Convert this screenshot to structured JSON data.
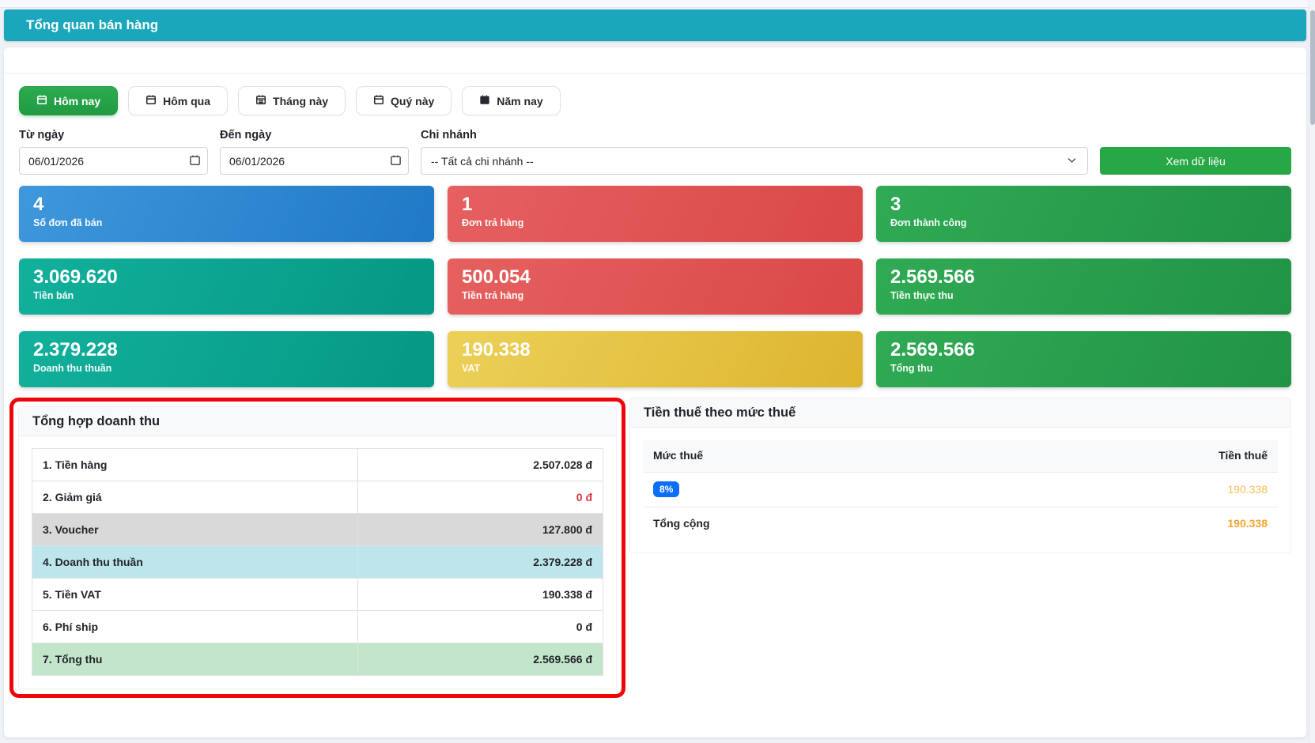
{
  "page": {
    "title": "Tổng quan bán hàng"
  },
  "filters": {
    "quick_buttons": [
      {
        "label": "Hôm nay",
        "active": true
      },
      {
        "label": "Hôm qua",
        "active": false
      },
      {
        "label": "Tháng này",
        "active": false
      },
      {
        "label": "Quý này",
        "active": false
      },
      {
        "label": "Năm nay",
        "active": false
      }
    ],
    "from_date": {
      "label": "Từ ngày",
      "value": "06/01/2026"
    },
    "to_date": {
      "label": "Đến ngày",
      "value": "06/01/2026"
    },
    "branch": {
      "label": "Chi nhánh",
      "value": "-- Tất cả chi nhánh --"
    },
    "view_button_label": "Xem dữ liệu"
  },
  "stat_cards": [
    {
      "value": "4",
      "label": "Số đơn đã bán",
      "color": "#2e8ad2"
    },
    {
      "value": "1",
      "label": "Đơn trả hàng",
      "color": "#e05353"
    },
    {
      "value": "3",
      "label": "Đơn thành công",
      "color": "#28a14d"
    },
    {
      "value": "3.069.620",
      "label": "Tiền bán",
      "color": "#0ca592"
    },
    {
      "value": "500.054",
      "label": "Tiền trả hàng",
      "color": "#e05353"
    },
    {
      "value": "2.569.566",
      "label": "Tiền thực thu",
      "color": "#28a14d"
    },
    {
      "value": "2.379.228",
      "label": "Doanh thu thuần",
      "color": "#0ca592"
    },
    {
      "value": "190.338",
      "label": "VAT",
      "color": "#e5c443"
    },
    {
      "value": "2.569.566",
      "label": "Tổng thu",
      "color": "#28a14d"
    }
  ],
  "revenue_summary": {
    "title": "Tổng hợp doanh thu",
    "rows": [
      {
        "label": "1. Tiền hàng",
        "value": "2.507.028 đ"
      },
      {
        "label": "2. Giảm giá",
        "value": "0 đ"
      },
      {
        "label": "3. Voucher",
        "value": "127.800 đ"
      },
      {
        "label": "4. Doanh thu thuần",
        "value": "2.379.228 đ"
      },
      {
        "label": "5. Tiền VAT",
        "value": "190.338 đ"
      },
      {
        "label": "6. Phí ship",
        "value": "0 đ"
      },
      {
        "label": "7. Tổng thu",
        "value": "2.569.566 đ"
      }
    ]
  },
  "tax_table": {
    "title": "Tiền thuế theo mức thuế",
    "columns": [
      "Mức thuế",
      "Tiền thuế"
    ],
    "rows": [
      {
        "rate": "8%",
        "amount": "190.338"
      }
    ],
    "total_label": "Tổng cộng",
    "total_amount": "190.338"
  },
  "colors": {
    "header_teal": "#1aa7bb",
    "active_button_green": "#28a745",
    "view_button_green": "#28a745",
    "badge_blue": "#0d6efd",
    "tax_amount_orange": "#f2a62e",
    "negative_value_red": "#dc3545",
    "annotation_border_red": "#ee0709",
    "row_highlight_gray": "#d9d9d9",
    "row_highlight_blue": "#bee5eb",
    "row_highlight_green": "#c3e6cb"
  }
}
